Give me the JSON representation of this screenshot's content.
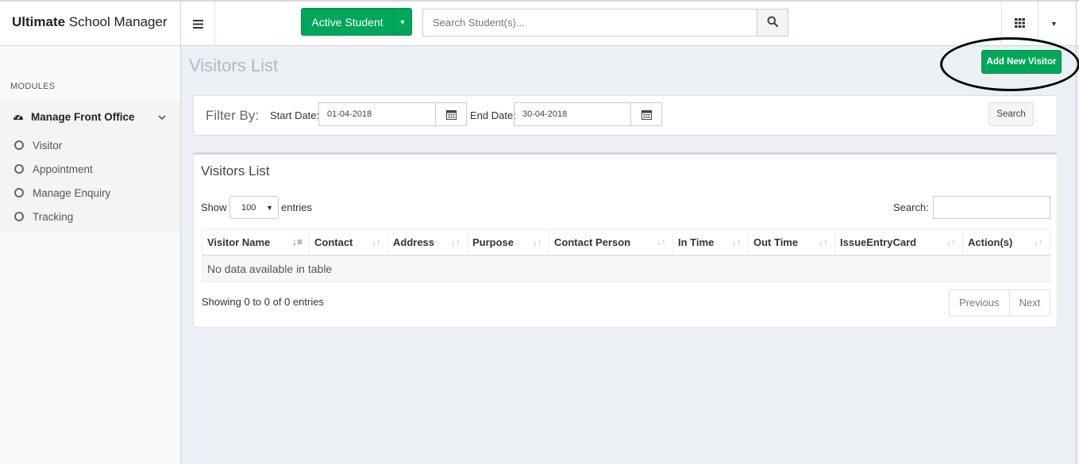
{
  "brand": {
    "bold": "Ultimate",
    "rest": " School Manager"
  },
  "header": {
    "active_student_label": "Active Student",
    "search_placeholder": "Search Student(s)...",
    "accent_color": "#00a65a"
  },
  "sidebar": {
    "modules_header": "MODULES",
    "group_label": "Manage Front Office",
    "items": [
      "Visitor",
      "Appointment",
      "Manage Enquiry",
      "Tracking"
    ]
  },
  "page": {
    "title": "Visitors List",
    "add_button": "Add New Visitor"
  },
  "filter": {
    "label": "Filter By:",
    "start_label": "Start Date:",
    "start_value": "01-04-2018",
    "end_label": "End Date:",
    "end_value": "30-04-2018",
    "search_button": "Search"
  },
  "list": {
    "title": "Visitors List",
    "show_label": "Show",
    "page_size": "100",
    "entries_label": "entries",
    "search_label": "Search:",
    "columns": [
      "Visitor Name",
      "Contact",
      "Address",
      "Purpose",
      "Contact Person",
      "In Time",
      "Out Time",
      "IssueEntryCard",
      "Action(s)"
    ],
    "empty_message": "No data available in table",
    "showing_text": "Showing 0 to 0 of 0 entries",
    "prev_label": "Previous",
    "next_label": "Next"
  }
}
